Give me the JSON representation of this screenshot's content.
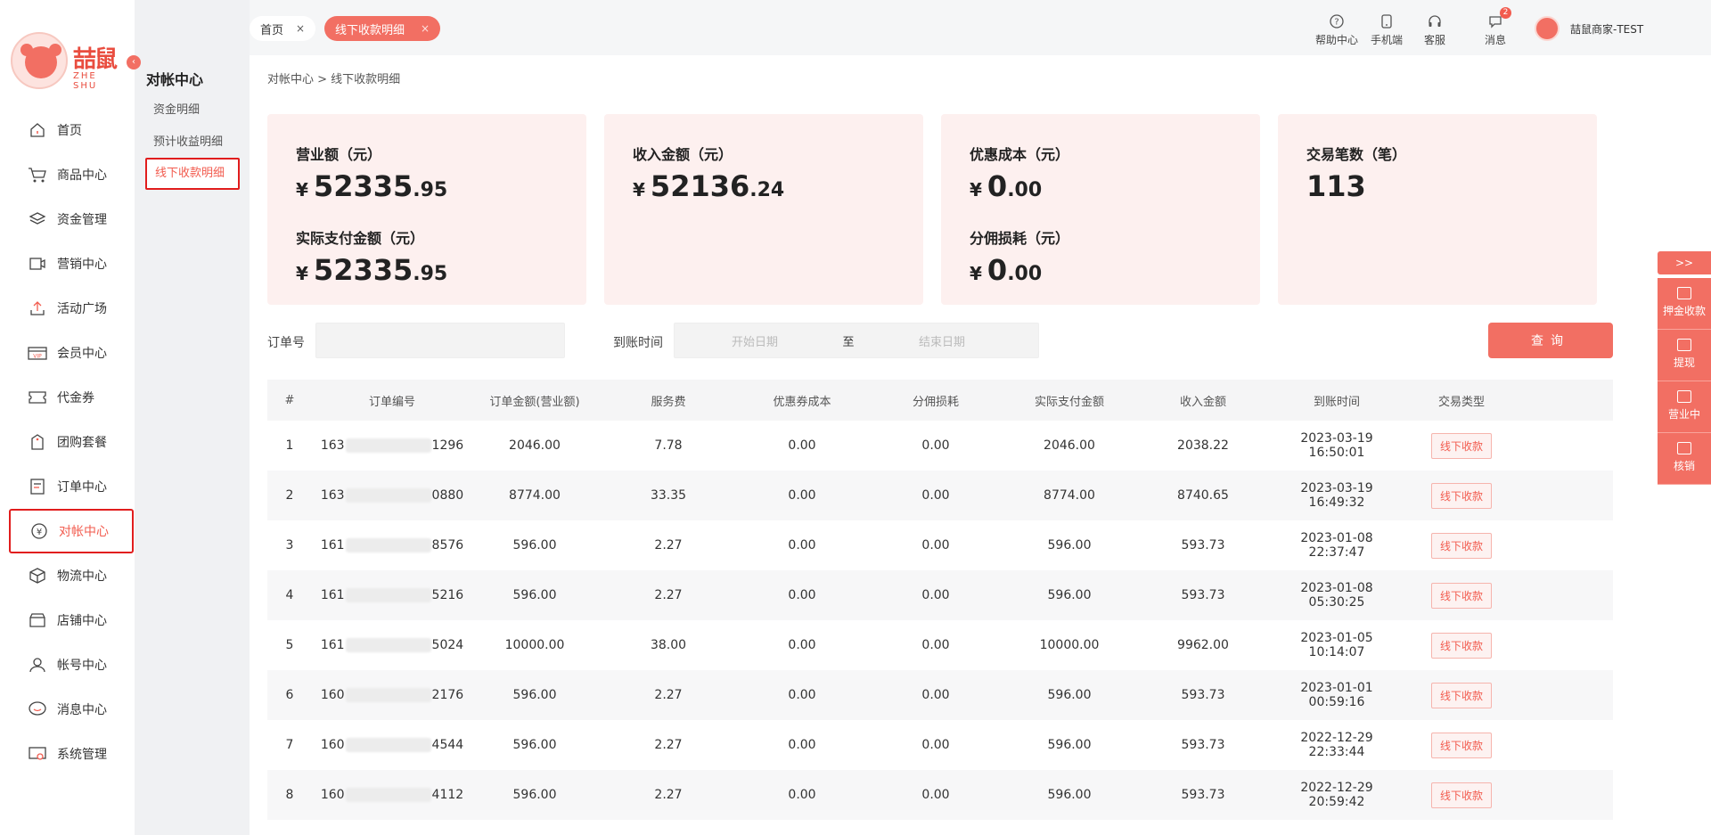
{
  "logo": {
    "text": "喆鼠",
    "sub": "ZHE SHU"
  },
  "nav": [
    {
      "label": "首页",
      "icon": "home-icon"
    },
    {
      "label": "商品中心",
      "icon": "cart-icon"
    },
    {
      "label": "资金管理",
      "icon": "layers-icon"
    },
    {
      "label": "营销中心",
      "icon": "marketing-icon"
    },
    {
      "label": "活动广场",
      "icon": "upload-icon"
    },
    {
      "label": "会员中心",
      "icon": "vip-icon"
    },
    {
      "label": "代金券",
      "icon": "coupon-icon"
    },
    {
      "label": "团购套餐",
      "icon": "tag-icon"
    },
    {
      "label": "订单中心",
      "icon": "order-icon"
    },
    {
      "label": "对帐中心",
      "icon": "yen-icon"
    },
    {
      "label": "物流中心",
      "icon": "box-icon"
    },
    {
      "label": "店铺中心",
      "icon": "shop-icon"
    },
    {
      "label": "帐号中心",
      "icon": "user-icon"
    },
    {
      "label": "消息中心",
      "icon": "message-icon"
    },
    {
      "label": "系统管理",
      "icon": "settings-icon"
    }
  ],
  "subnav": {
    "title": "对帐中心",
    "items": [
      "资金明细",
      "预计收益明细",
      "线下收款明细"
    ]
  },
  "tabs": {
    "home": "首页",
    "current": "线下收款明细",
    "close": "×"
  },
  "tools": {
    "help": "帮助中心",
    "mobile": "手机端",
    "service": "客服",
    "message": "消息",
    "message_badge": "2"
  },
  "user": {
    "name": "喆鼠商家-TEST"
  },
  "breadcrumb": "对帐中心  > 线下收款明细",
  "cards": [
    {
      "label": "营业额（元）",
      "int": "52335",
      "dec": ".95",
      "label2": "实际支付金额（元）",
      "int2": "52335",
      "dec2": ".95"
    },
    {
      "label": "收入金额（元）",
      "int": "52136",
      "dec": ".24"
    },
    {
      "label": "优惠成本（元）",
      "int": "0",
      "dec": ".00",
      "label2": "分佣损耗（元）",
      "int2": "0",
      "dec2": ".00"
    },
    {
      "label": "交易笔数（笔）",
      "count": "113"
    }
  ],
  "currency": "¥",
  "filter": {
    "order_label": "订单号",
    "time_label": "到账时间",
    "start_placeholder": "开始日期",
    "to": "至",
    "end_placeholder": "结束日期",
    "query": "查询"
  },
  "table": {
    "headers": [
      "#",
      "订单编号",
      "订单金额(营业额)",
      "服务费",
      "优惠券成本",
      "分佣损耗",
      "实际支付金额",
      "收入金额",
      "到账时间",
      "交易类型"
    ],
    "rows": [
      {
        "n": "1",
        "pre": "163",
        "suf": "1296",
        "amt": "2046.00",
        "fee": "7.78",
        "coupon": "0.00",
        "comm": "0.00",
        "paid": "2046.00",
        "income": "2038.22",
        "time": "2023-03-19 16:50:01",
        "type": "线下收款"
      },
      {
        "n": "2",
        "pre": "163",
        "suf": "0880",
        "amt": "8774.00",
        "fee": "33.35",
        "coupon": "0.00",
        "comm": "0.00",
        "paid": "8774.00",
        "income": "8740.65",
        "time": "2023-03-19 16:49:32",
        "type": "线下收款"
      },
      {
        "n": "3",
        "pre": "161",
        "suf": "8576",
        "amt": "596.00",
        "fee": "2.27",
        "coupon": "0.00",
        "comm": "0.00",
        "paid": "596.00",
        "income": "593.73",
        "time": "2023-01-08 22:37:47",
        "type": "线下收款"
      },
      {
        "n": "4",
        "pre": "161",
        "suf": "5216",
        "amt": "596.00",
        "fee": "2.27",
        "coupon": "0.00",
        "comm": "0.00",
        "paid": "596.00",
        "income": "593.73",
        "time": "2023-01-08 05:30:25",
        "type": "线下收款"
      },
      {
        "n": "5",
        "pre": "161",
        "suf": "5024",
        "amt": "10000.00",
        "fee": "38.00",
        "coupon": "0.00",
        "comm": "0.00",
        "paid": "10000.00",
        "income": "9962.00",
        "time": "2023-01-05 10:14:07",
        "type": "线下收款"
      },
      {
        "n": "6",
        "pre": "160",
        "suf": "2176",
        "amt": "596.00",
        "fee": "2.27",
        "coupon": "0.00",
        "comm": "0.00",
        "paid": "596.00",
        "income": "593.73",
        "time": "2023-01-01 00:59:16",
        "type": "线下收款"
      },
      {
        "n": "7",
        "pre": "160",
        "suf": "4544",
        "amt": "596.00",
        "fee": "2.27",
        "coupon": "0.00",
        "comm": "0.00",
        "paid": "596.00",
        "income": "593.73",
        "time": "2022-12-29 22:33:44",
        "type": "线下收款"
      },
      {
        "n": "8",
        "pre": "160",
        "suf": "4112",
        "amt": "596.00",
        "fee": "2.27",
        "coupon": "0.00",
        "comm": "0.00",
        "paid": "596.00",
        "income": "593.73",
        "time": "2022-12-29 20:59:42",
        "type": "线下收款"
      }
    ]
  },
  "float": {
    "toggle": ">>",
    "items": [
      "押金收款",
      "提现",
      "营业中",
      "核销"
    ]
  },
  "colors": {
    "accent": "#f26f63",
    "card_bg": "#fdf0ef",
    "highlight": "#e11d1d"
  }
}
